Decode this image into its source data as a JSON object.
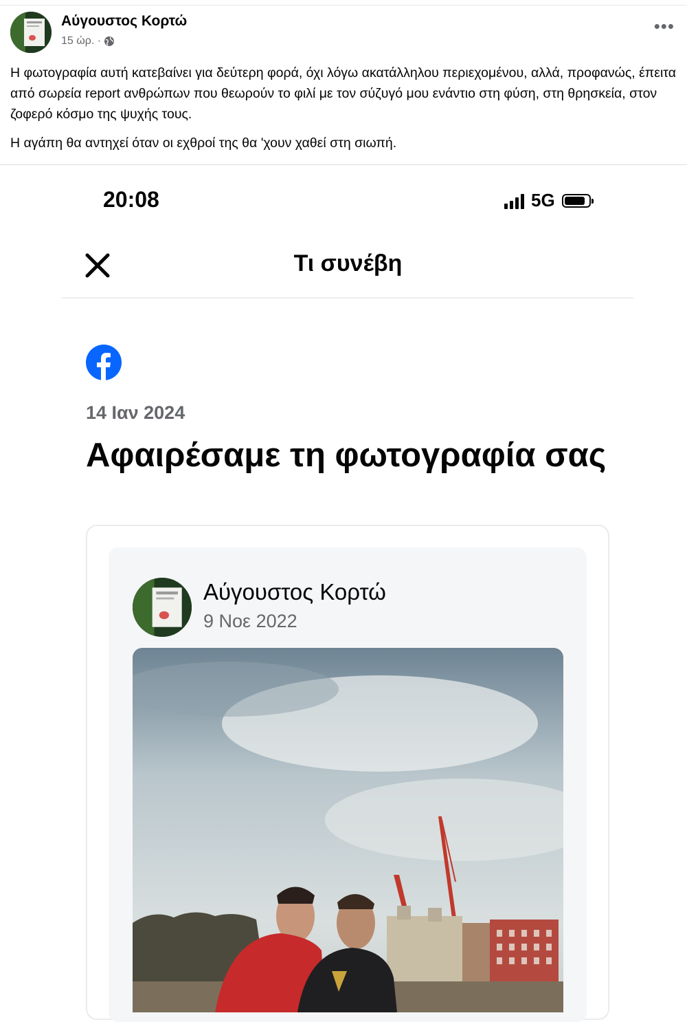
{
  "post": {
    "author": "Αύγουστος Κορτώ",
    "time": "15 ώρ. ·",
    "privacy_icon": "globe-icon",
    "more_label": "•••",
    "paragraphs": [
      "Η φωτογραφία αυτή κατεβαίνει για δεύτερη φορά, όχι λόγω ακατάλληλου περιεχομένου, αλλά, προφανώς, έπειτα από σωρεία report ανθρώπων που θεωρούν το φιλί με τον σύζυγό μου ενάντιο στη φύση, στη θρησκεία, στον ζοφερό κόσμο της ψυχής τους.",
      "Η αγάπη θα αντηχεί όταν οι εχθροί της θα 'χουν χαθεί στη σιωπή."
    ]
  },
  "phone": {
    "status_time": "20:08",
    "network": "5G",
    "battery_level": 0.85
  },
  "sheet": {
    "title": "Τι συνέβη",
    "notice_date": "14 Ιαν 2024",
    "notice_title": "Αφαιρέσαμε τη φωτογραφία σας"
  },
  "embedded_post": {
    "author": "Αύγουστος Κορτώ",
    "date": "9 Νοε 2022"
  },
  "colors": {
    "facebook_blue": "#0866ff",
    "secondary_text": "#65676b"
  }
}
